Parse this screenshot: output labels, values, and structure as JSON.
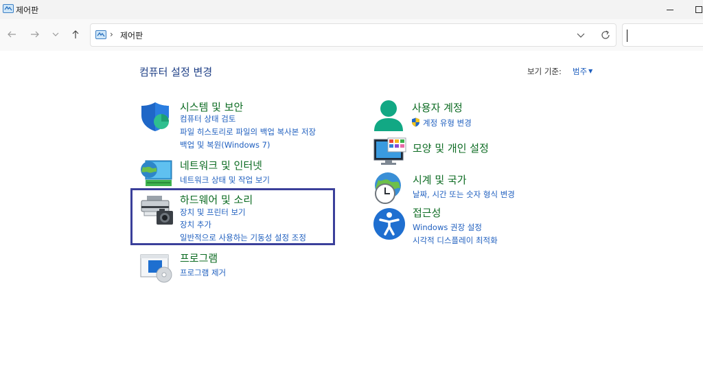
{
  "window": {
    "title": "제어판"
  },
  "address_bar": {
    "separator": "›",
    "location": "제어판"
  },
  "header": {
    "title": "컴퓨터 설정 변경",
    "view_by_label": "보기 기준:",
    "view_by_value": "범주"
  },
  "categories": {
    "system": {
      "title": "시스템 및 보안",
      "links": [
        "컴퓨터 상태 검토",
        "파일 히스토리로 파일의 백업 복사본 저장",
        "백업 및 복원(Windows 7)"
      ]
    },
    "network": {
      "title": "네트워크 및 인터넷",
      "links": [
        "네트워크 상태 및 작업 보기"
      ]
    },
    "hardware": {
      "title": "하드웨어 및 소리",
      "links": [
        "장치 및 프린터 보기",
        "장치 추가",
        "일반적으로 사용하는 기동성 설정 조정"
      ]
    },
    "programs": {
      "title": "프로그램",
      "links": [
        "프로그램 제거"
      ]
    },
    "accounts": {
      "title": "사용자 계정",
      "links": [
        "계정 유형 변경"
      ]
    },
    "appearance": {
      "title": "모양 및 개인 설정",
      "links": []
    },
    "clock": {
      "title": "시계 및 국가",
      "links": [
        "날짜, 시간 또는 숫자 형식 변경"
      ]
    },
    "access": {
      "title": "접근성",
      "links": [
        "Windows 권장 설정",
        "시각적 디스플레이 최적화"
      ]
    }
  },
  "colors": {
    "category_title": "#0c6b22",
    "link": "#1f5fbf",
    "page_title": "#1e3f86",
    "highlight_border": "#3a3f9a"
  },
  "icons": {
    "window": "control-panel-icon",
    "system": "shield-icon",
    "network": "globe-monitor-icon",
    "hardware": "printer-camera-icon",
    "programs": "programs-disc-icon",
    "accounts": "user-icon",
    "appearance": "monitor-palette-icon",
    "clock": "globe-clock-icon",
    "access": "accessibility-icon",
    "uac": "uac-shield-icon"
  }
}
